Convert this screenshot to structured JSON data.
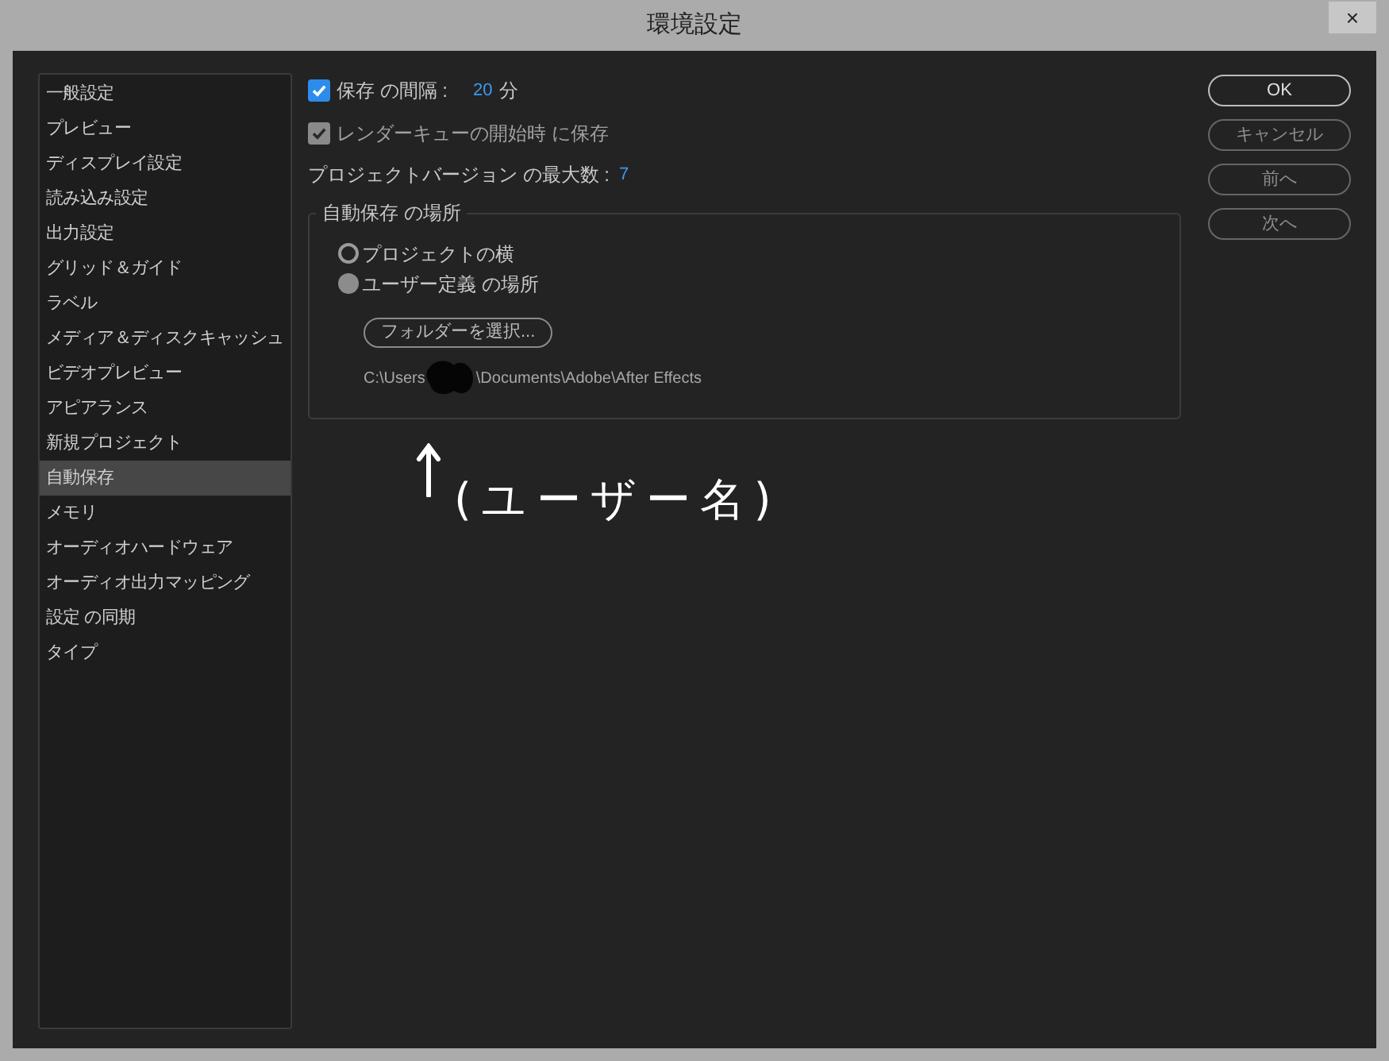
{
  "window": {
    "title": "環境設定",
    "close": "×"
  },
  "sidebar": {
    "items": [
      {
        "label": "一般設定",
        "selected": false
      },
      {
        "label": "プレビュー",
        "selected": false
      },
      {
        "label": "ディスプレイ設定",
        "selected": false
      },
      {
        "label": "読み込み設定",
        "selected": false
      },
      {
        "label": "出力設定",
        "selected": false
      },
      {
        "label": "グリッド＆ガイド",
        "selected": false
      },
      {
        "label": "ラベル",
        "selected": false
      },
      {
        "label": "メディア＆ディスクキャッシュ",
        "selected": false
      },
      {
        "label": "ビデオプレビュー",
        "selected": false
      },
      {
        "label": "アピアランス",
        "selected": false
      },
      {
        "label": "新規プロジェクト",
        "selected": false
      },
      {
        "label": "自動保存",
        "selected": true
      },
      {
        "label": "メモリ",
        "selected": false
      },
      {
        "label": "オーディオハードウェア",
        "selected": false
      },
      {
        "label": "オーディオ出力マッピング",
        "selected": false
      },
      {
        "label": "設定 の同期",
        "selected": false
      },
      {
        "label": "タイプ",
        "selected": false
      }
    ]
  },
  "save_interval": {
    "label": "保存 の間隔 :",
    "checked": true,
    "value": "20",
    "unit": "分"
  },
  "render_queue": {
    "label": "レンダーキューの開始時 に保存",
    "checked": true,
    "disabled": true
  },
  "max_versions": {
    "label": "プロジェクトバージョン の最大数 :",
    "value": "7"
  },
  "location": {
    "title": "自動保存 の場所",
    "options": [
      {
        "label": "プロジェクトの横",
        "selected": false
      },
      {
        "label": "ユーザー定義 の場所",
        "selected": true
      }
    ],
    "button": "フォルダーを選択...",
    "path_start": "C:\\Users",
    "path_end": "\\Documents\\Adobe\\After Effects"
  },
  "annotation": "(ユーザー名)",
  "buttons": [
    {
      "label": "OK",
      "disabled": false
    },
    {
      "label": "キャンセル",
      "disabled": true
    },
    {
      "label": "前へ",
      "disabled": true
    },
    {
      "label": "次へ",
      "disabled": true
    }
  ]
}
